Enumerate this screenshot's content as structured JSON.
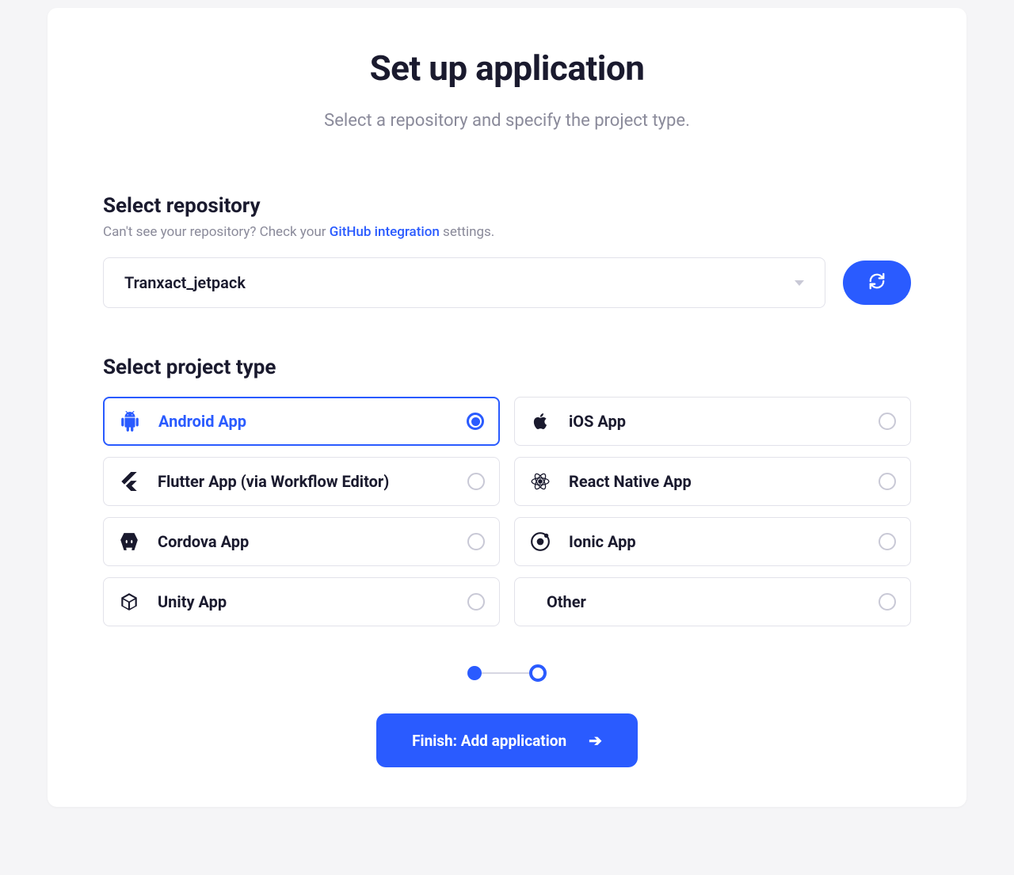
{
  "header": {
    "title": "Set up application",
    "subtitle": "Select a repository and specify the project type."
  },
  "repository": {
    "section_title": "Select repository",
    "help_prefix": "Can't see your repository? Check your ",
    "help_link": "GitHub integration",
    "help_suffix": " settings.",
    "selected_value": "Tranxact_jetpack"
  },
  "project_type": {
    "section_title": "Select project type",
    "selected": "android",
    "options": [
      {
        "id": "android",
        "label": "Android App",
        "icon": "android"
      },
      {
        "id": "ios",
        "label": "iOS App",
        "icon": "apple"
      },
      {
        "id": "flutter",
        "label": "Flutter App (via Workflow Editor)",
        "icon": "flutter"
      },
      {
        "id": "react-native",
        "label": "React Native App",
        "icon": "react"
      },
      {
        "id": "cordova",
        "label": "Cordova App",
        "icon": "cordova"
      },
      {
        "id": "ionic",
        "label": "Ionic App",
        "icon": "ionic"
      },
      {
        "id": "unity",
        "label": "Unity App",
        "icon": "unity"
      },
      {
        "id": "other",
        "label": "Other",
        "icon": ""
      }
    ]
  },
  "stepper": {
    "current": 1,
    "total": 2
  },
  "finish_button": {
    "label": "Finish: Add application"
  },
  "colors": {
    "accent": "#2a5bff",
    "text": "#1a1a2e",
    "muted": "#8a8a9a",
    "border": "#e2e2ea"
  }
}
